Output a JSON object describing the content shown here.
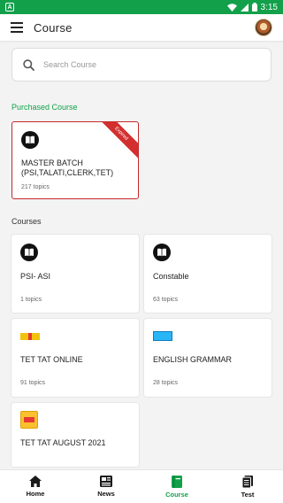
{
  "status_bar": {
    "app_icon_letter": "A",
    "time": "3:15"
  },
  "app_bar": {
    "title": "Course"
  },
  "search": {
    "placeholder": "Search Course"
  },
  "purchased": {
    "title": "Purchased Course",
    "card": {
      "name": "MASTER BATCH (PSI,TALATI,CLERK,TET)",
      "topics": "217 topics",
      "badge": "Expired"
    }
  },
  "courses": {
    "title": "Courses",
    "items": [
      {
        "name": "PSI- ASI",
        "topics": "1 topics",
        "icon": "book-icon"
      },
      {
        "name": "Constable",
        "topics": "63 topics",
        "icon": "book-icon"
      },
      {
        "name": "TET TAT ONLINE",
        "topics": "91 topics",
        "icon": "course-logo-icon"
      },
      {
        "name": "ENGLISH GRAMMAR",
        "topics": "28 topics",
        "icon": "english-grammar-logo-icon"
      },
      {
        "name": "TET TAT AUGUST 2021",
        "topics": "",
        "icon": "tet-tat-logo-icon"
      }
    ]
  },
  "bottom_nav": {
    "items": [
      {
        "label": "Home",
        "icon": "home-icon"
      },
      {
        "label": "News",
        "icon": "news-icon"
      },
      {
        "label": "Course",
        "icon": "course-icon",
        "active": true
      },
      {
        "label": "Test",
        "icon": "test-icon"
      }
    ]
  },
  "colors": {
    "status_bar": "#12a04a",
    "accent": "#12a04a",
    "expired": "#d32f2f"
  }
}
